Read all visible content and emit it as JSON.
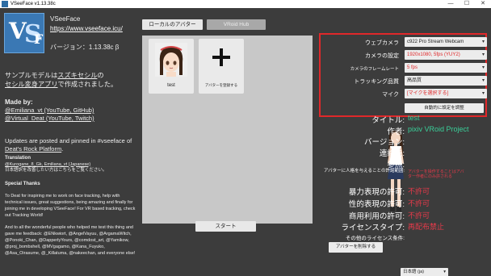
{
  "window": {
    "title": "VSeeFace v1.13.38c",
    "controls": [
      "—",
      "☐",
      "✕"
    ]
  },
  "left": {
    "logo": {
      "v": "V",
      "s": "S",
      "f": "F"
    },
    "app_name": "VSeeFace",
    "url": "https://www.vseeface.icu/",
    "version": "バージョン：1.13.38c β",
    "desc_before": "サンプルモデルは",
    "desc_link1": "スズキセシル",
    "desc_mid": "の",
    "desc_link2": "セシル変身アプリ",
    "desc_after": "で作成されました。",
    "madeby_label": "Made by:",
    "madeby_line1": "@Emiliana_vt (YouTube, GitHub)",
    "madeby_line2": "@Virtual_Deat (YouTube, Twitch)",
    "updates_before": "Updates are posted and pinned in #vseeface of ",
    "updates_link": "Deat's Rock Platform",
    "updates_after": ".",
    "translation_label": "Translation",
    "translation_line1": "@Kurogane_8_Gk, Emiliana_vt (Japanese)",
    "translation_line2": "日本語訳を改善したい方はこちらをご覧ください。",
    "special_label": "Special Thanks",
    "special_p1": "To Deat for inspiring me to work on face tracking, help with technical issues, great suggestions, being amazing and finally for joining me in developing VSeeFace! For VR based tracking, check out Tracking World!",
    "special_p2": "And to all the wonderful people who helped me test this thing and gave me feedback: @ENkwiort, @AngelVayuu, @ArgamaWitch, @Ponoki_Chan, @DapperlyYours, @comdost_art, @Yamikow, @proj_bombshell, @MVgagamo, @Kana_Fuyuko, @Asa_Oirasume, @_Killatuma, @nakeechan, and everyone else!"
  },
  "middle": {
    "tabs": [
      {
        "label": "ローカルのアバター",
        "active": true
      },
      {
        "label": "VRoid Hub",
        "active": false
      }
    ],
    "avatars": [
      {
        "label": "test"
      },
      {
        "label": "アバターを登録する"
      }
    ],
    "start_label": "スタート"
  },
  "right": {
    "settings": [
      {
        "label": "ウェブカメラ",
        "value": "c922 Pro Stream Webcam",
        "warn": false
      },
      {
        "label": "カメラの設定",
        "value": "1920x1080, 5fps (YUY2)",
        "warn": true
      },
      {
        "label": "カメラのフレームレート",
        "value": "5 fps",
        "warn": true
      },
      {
        "label": "トラッキング品質",
        "value": "高品質",
        "warn": false
      },
      {
        "label": "マイク",
        "value": "[マイクを選択する]",
        "warn": true
      }
    ],
    "auto_label": "自動的に設定を調整",
    "info": {
      "title_label": "タイトル:",
      "title_value": "test",
      "author_label": "作者:",
      "author_value": "pixiv VRoid Project",
      "version_label": "バージョン:",
      "contact_label": "連絡先:",
      "reference_label": "参照:",
      "personation_label": "アバターに人格を与えることの許諾範囲:",
      "personation_value": "アバターを操作することはアバター作者にのみ許される",
      "violence_label": "暴力表現の許可:",
      "violence_value": "不許可",
      "sexual_label": "性的表現の許可:",
      "sexual_value": "不許可",
      "commercial_label": "商用利用の許可:",
      "commercial_value": "不許可",
      "license_label": "ライセンスタイプ:",
      "license_value": "再配布禁止",
      "other_label": "その他のライセンス条件:"
    },
    "delete_label": "アバターを削除する",
    "language": "日本語 (ja)"
  },
  "colors": {
    "warning": "#e0282a",
    "value_green": "#3ad09a",
    "value_red": "#e83a4a",
    "logo_blue": "#3a78b4"
  }
}
